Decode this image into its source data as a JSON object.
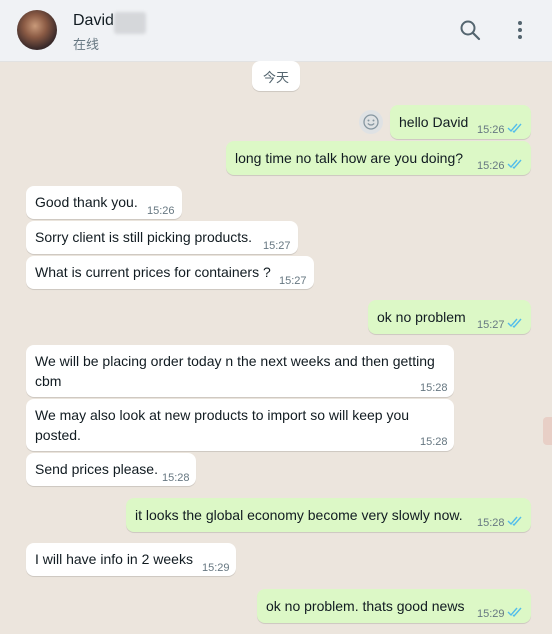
{
  "header": {
    "name": "David",
    "status": "在线"
  },
  "date_chip": "今天",
  "messages": [
    {
      "dir": "out",
      "text": "hello David",
      "time": "15:26"
    },
    {
      "dir": "out",
      "text": "long time no talk how are you doing?",
      "time": "15:26"
    },
    {
      "dir": "in",
      "text": "Good thank you.",
      "time": "15:26"
    },
    {
      "dir": "in",
      "text": "Sorry client is still picking products.",
      "time": "15:27"
    },
    {
      "dir": "in",
      "text": "What is current prices for containers ?",
      "time": "15:27"
    },
    {
      "dir": "out",
      "text": "ok no problem",
      "time": "15:27"
    },
    {
      "dir": "in",
      "text": "We will be placing order today n the next weeks and then getting",
      "text2": "cbm",
      "time": "15:28"
    },
    {
      "dir": "in",
      "text": "We may also look at new products to import so will keep you",
      "text2": "posted.",
      "time": "15:28"
    },
    {
      "dir": "in",
      "text": "Send prices please.",
      "time": "15:28"
    },
    {
      "dir": "out",
      "text": "it looks the global economy become very slowly now.",
      "time": "15:28"
    },
    {
      "dir": "in",
      "text": "I will have info in 2 weeks",
      "time": "15:29"
    },
    {
      "dir": "out",
      "text": "ok no problem. thats good news",
      "time": "15:29"
    }
  ],
  "icons": {
    "search": "search-icon",
    "menu": "menu-icon",
    "emoji": "emoji-icon",
    "read": "double-check-icon"
  },
  "colors": {
    "incoming": "#ffffff",
    "outgoing": "#dcf8c6",
    "read_tick": "#53bdeb",
    "wallpaper": "#ece5dd"
  }
}
